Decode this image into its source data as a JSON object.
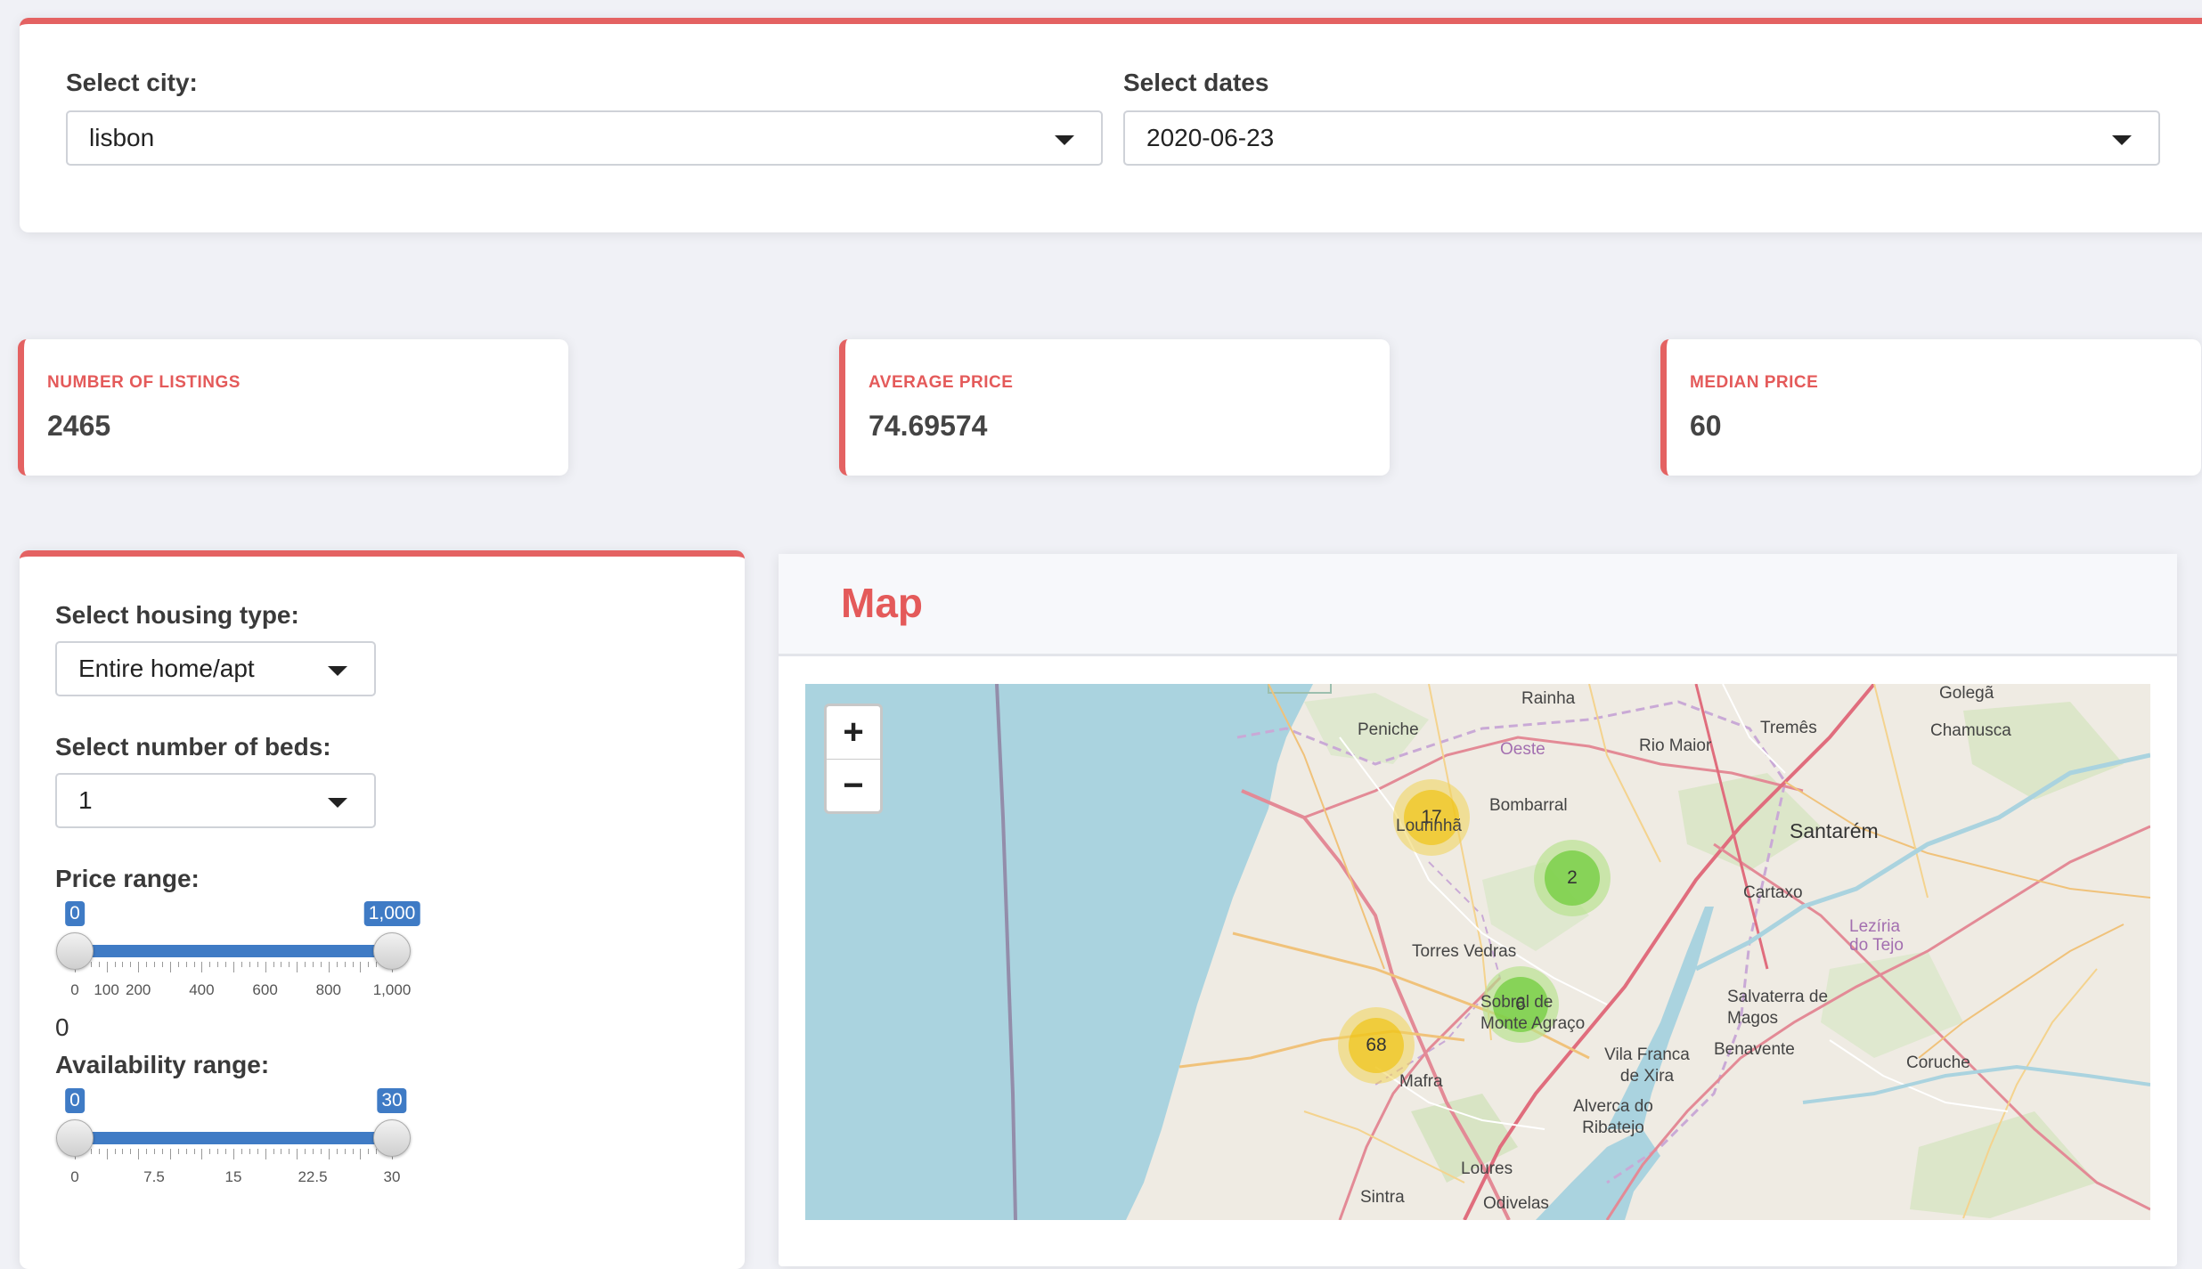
{
  "filters": {
    "city_label": "Select city:",
    "city_value": "lisbon",
    "dates_label": "Select dates",
    "dates_value": "2020-06-23"
  },
  "stats": [
    {
      "title": "NUMBER OF LISTINGS",
      "value": "2465"
    },
    {
      "title": "AVERAGE PRICE",
      "value": "74.69574"
    },
    {
      "title": "MEDIAN PRICE",
      "value": "60"
    }
  ],
  "sidebar": {
    "housing_label": "Select housing type:",
    "housing_value": "Entire home/apt",
    "beds_label": "Select number of beds:",
    "beds_value": "1",
    "price_label": "Price range:",
    "price_slider": {
      "min": 0,
      "max": 1000,
      "from": 0,
      "to": 1000,
      "from_label": "0",
      "to_label": "1,000",
      "ticks": [
        "0",
        "100",
        "200",
        "400",
        "600",
        "800",
        "1,000"
      ]
    },
    "price_output": "0",
    "availability_label": "Availability range:",
    "availability_slider": {
      "min": 0,
      "max": 30,
      "from": 0,
      "to": 30,
      "from_label": "0",
      "to_label": "30",
      "ticks": [
        "0",
        "7.5",
        "15",
        "22.5",
        "30"
      ]
    }
  },
  "map_panel": {
    "title": "Map",
    "zoom_in": "+",
    "zoom_out": "−",
    "clusters": [
      {
        "count": "17",
        "color": "yellow"
      },
      {
        "count": "2",
        "color": "green"
      },
      {
        "count": "6",
        "color": "green"
      },
      {
        "count": "68",
        "color": "yellow"
      }
    ],
    "places": [
      "Rainha",
      "Golegã",
      "Peniche",
      "Tremês",
      "Chamusca",
      "Oeste",
      "Rio Maior",
      "Lourinhã",
      "Bombarral",
      "Santarém",
      "Cartaxo",
      "Lezíria do Tejo",
      "Torres Vedras",
      "Sobral de Monte Agraço",
      "Salvaterra de Magos",
      "Benavente",
      "Mafra",
      "Vila Franca de Xira",
      "Coruche",
      "Alverca do Ribatejo",
      "Loures",
      "Sintra",
      "Odivelas"
    ]
  }
}
